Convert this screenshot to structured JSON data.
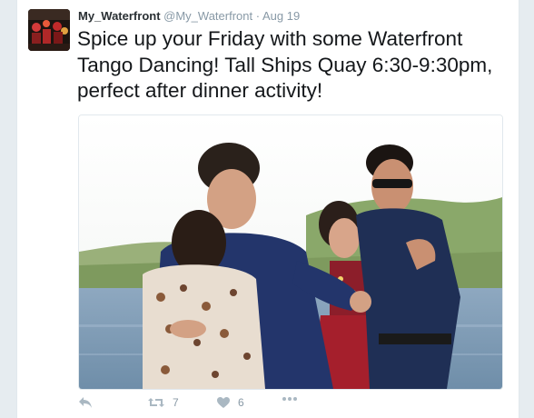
{
  "tweet": {
    "display_name": "My_Waterfront",
    "handle": "@My_Waterfront",
    "separator": "·",
    "date": "Aug 19",
    "text": "Spice up your Friday with some Waterfront Tango Dancing! Tall Ships Quay 6:30-9:30pm, perfect after dinner activity!"
  },
  "actions": {
    "reply_icon": "reply-icon",
    "retweet_icon": "retweet-icon",
    "retweet_count": "7",
    "like_icon": "heart-icon",
    "like_count": "6",
    "more_icon": "more-icon"
  },
  "colors": {
    "background": "#e6ecf0",
    "card": "#ffffff",
    "text": "#14171a",
    "muted": "#8899a6",
    "icon": "#aab8c2"
  }
}
